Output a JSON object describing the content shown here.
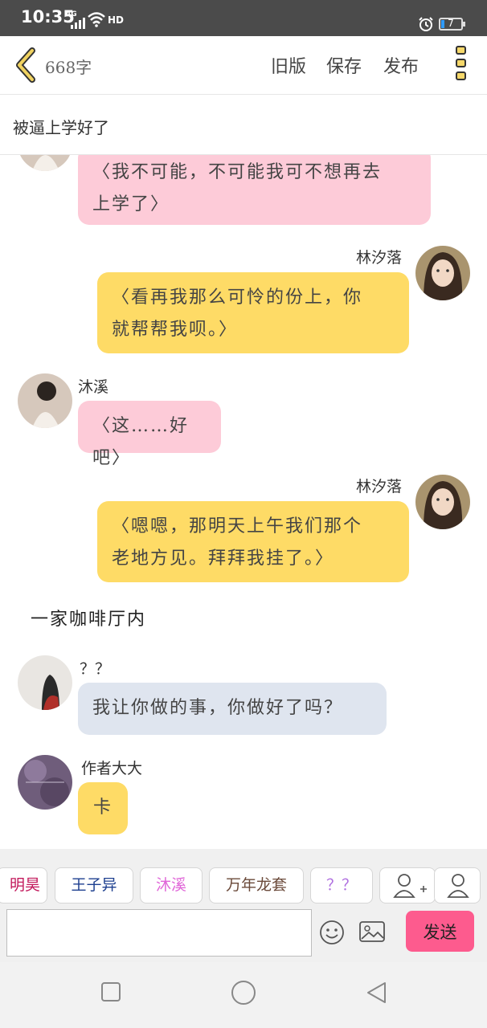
{
  "status_bar": {
    "time": "10:35",
    "network": "4G",
    "hd": "HD",
    "battery": "7"
  },
  "top_bar": {
    "word_count": "668字",
    "old_version": "旧版",
    "save": "保存",
    "publish": "发布"
  },
  "story_title": "被逼上学好了",
  "messages": [
    {
      "speaker": "",
      "text_lines": [
        "〈我不可能，不可能我可不想再去",
        "上学了〉"
      ],
      "color": "#fdcbd8"
    },
    {
      "speaker": "林汐落",
      "text_lines": [
        "〈看再我那么可怜的份上，你",
        "就帮帮我呗。〉"
      ],
      "color": "#fedb66"
    },
    {
      "speaker": "沐溪",
      "text_lines": [
        "〈这……好吧〉"
      ],
      "color": "#fdcbd8"
    },
    {
      "speaker": "林汐落",
      "text_lines": [
        "〈嗯嗯，那明天上午我们那个",
        "老地方见。拜拜我挂了。〉"
      ],
      "color": "#fedb66"
    },
    {
      "speaker": "？？",
      "text_lines": [
        "我让你做的事，你做好了吗？"
      ],
      "color": "#dfe5ef"
    },
    {
      "speaker": "作者大大",
      "text_lines": [
        "卡"
      ],
      "color": "#fedb66"
    }
  ],
  "narration": "一家咖啡厅内",
  "characters": [
    {
      "name": "明昊",
      "color": "#c2185b"
    },
    {
      "name": "王子异",
      "color": "#1d3f8f"
    },
    {
      "name": "沐溪",
      "color": "#e066d8"
    },
    {
      "name": "万年龙套",
      "color": "#6b4a3a"
    },
    {
      "name": "？？",
      "color": "#b070e0"
    }
  ],
  "input": {
    "placeholder": "",
    "send_label": "发送"
  },
  "colors": {
    "accent": "#fd5b8e",
    "self_bubble": "#fedb66",
    "other_bubble": "#fdcbd8",
    "back_arrow": "#f0d260"
  },
  "icons": [
    "back-arrow-icon",
    "more-icon",
    "add-character-icon",
    "character-icon",
    "emoji-icon",
    "image-icon",
    "square-nav-icon",
    "circle-nav-icon",
    "triangle-nav-icon"
  ]
}
